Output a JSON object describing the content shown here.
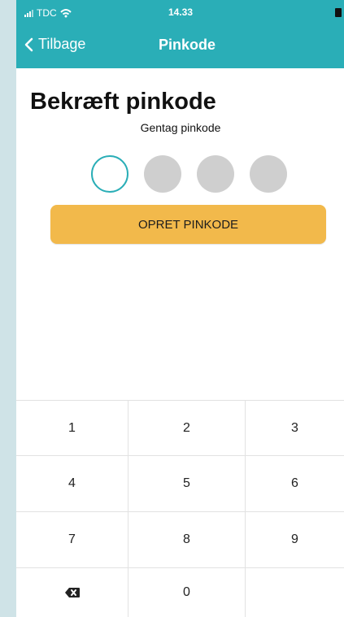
{
  "status_bar": {
    "carrier": "TDC",
    "time": "14.33"
  },
  "nav": {
    "back_label": "Tilbage",
    "title": "Pinkode"
  },
  "page": {
    "heading": "Bekræft pinkode",
    "subtitle": "Gentag pinkode"
  },
  "pin": {
    "length": 4,
    "entered": 0
  },
  "actions": {
    "create_pin": "OPRET PINKODE"
  },
  "keypad": {
    "keys": [
      "1",
      "2",
      "3",
      "4",
      "5",
      "6",
      "7",
      "8",
      "9",
      "",
      "0",
      ""
    ]
  },
  "colors": {
    "brand": "#2aaeb7",
    "button": "#f2b94b",
    "inactive_dot": "#cfcfcf"
  },
  "icons": {
    "back": "chevron-left-icon",
    "delete": "backspace-icon",
    "wifi": "wifi-icon",
    "battery": "battery-icon"
  }
}
